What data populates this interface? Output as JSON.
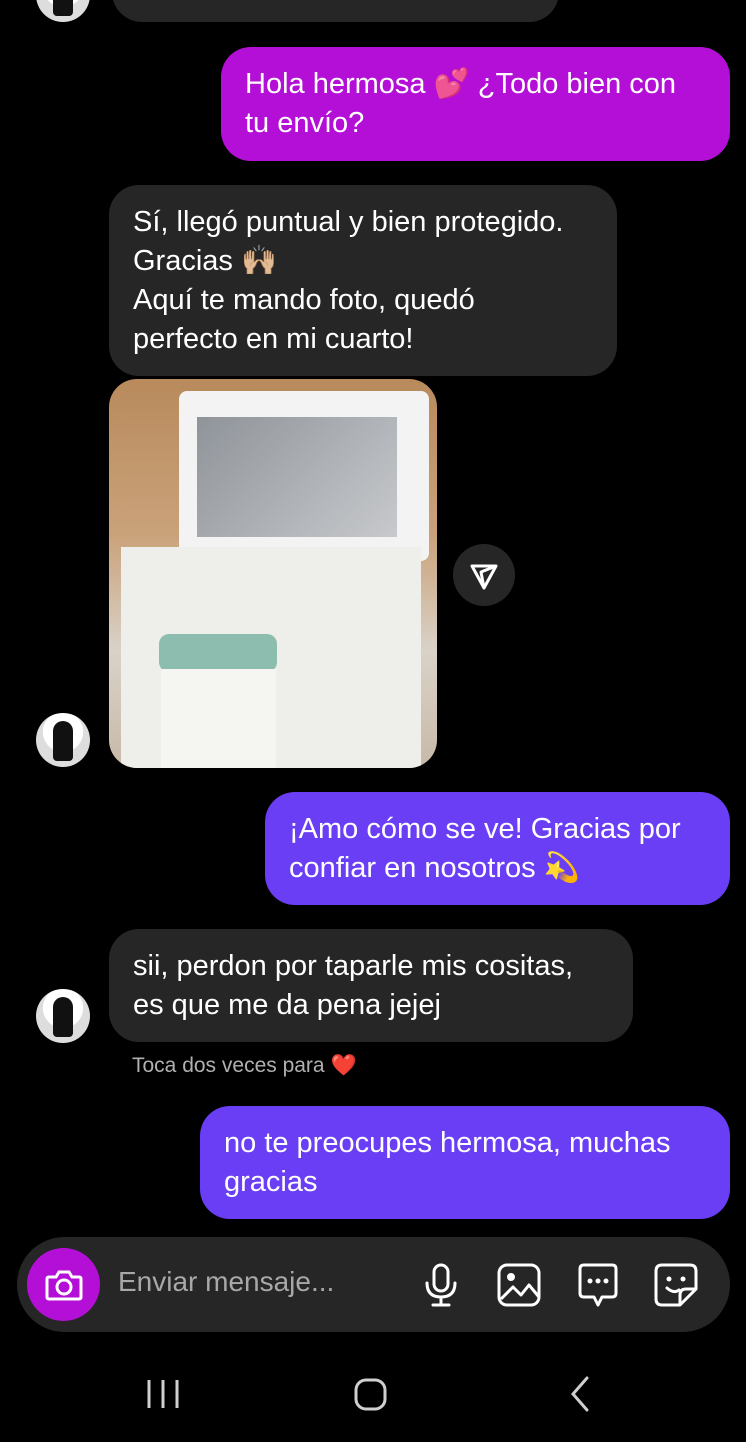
{
  "messages": [
    {
      "from": "me",
      "text": "Hola hermosa 💕 ¿Todo bien con\ntu envío?"
    },
    {
      "from": "them",
      "text": "Sí, llegó puntual y bien protegido.\nGracias 🙌🏼\nAquí te mando foto, quedó\nperfecto en mi cuarto!"
    },
    {
      "from": "me",
      "text": "¡Amo cómo se ve! Gracias por\nconfiar en nosotros 💫"
    },
    {
      "from": "them",
      "text": "sii, perdon por taparle mis cositas,\nes que me da pena jejej"
    },
    {
      "from": "me",
      "text": "no te preocupes hermosa, muchas\ngracias"
    }
  ],
  "hint": "Toca dos veces para",
  "hint_icon": "❤️",
  "composer": {
    "placeholder": "Enviar mensaje..."
  },
  "icons": {
    "camera": "camera-icon",
    "mic": "microphone-icon",
    "gallery": "image-icon",
    "chat": "chat-bubble-icon",
    "sticker": "sticker-icon",
    "share": "send-icon"
  },
  "colors": {
    "magenta": "#b40fd6",
    "purple": "#6a3ef4",
    "incoming": "#262626"
  }
}
